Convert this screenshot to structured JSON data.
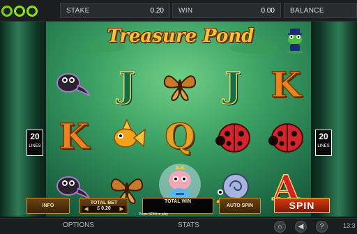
{
  "header": {
    "logo_text": "GECO",
    "stake_label": "STAKE",
    "stake_value": "0.20",
    "win_label": "WIN",
    "win_value": "0.00",
    "balance_label": "BALANCE"
  },
  "game": {
    "title": "Treasure Pond",
    "lines_left": {
      "count": "20",
      "label": "LINES"
    },
    "lines_right": {
      "count": "20",
      "label": "LINES"
    },
    "reels": [
      [
        "tadpole",
        "K",
        "tadpole"
      ],
      [
        "J",
        "goldfish",
        "butterfly"
      ],
      [
        "butterfly",
        "Q",
        "princess"
      ],
      [
        "J",
        "ladybird",
        "snail"
      ],
      [
        "K",
        "ladybird",
        "A"
      ]
    ]
  },
  "panel": {
    "info_label": "INFO",
    "total_bet_label": "TOTAL BET",
    "total_bet_value": "£ 0.20",
    "total_win_label": "TOTAL WIN",
    "auto_spin_label": "AUTO SPIN",
    "spin_label": "SPIN",
    "press_hint": "Press SPIN to play"
  },
  "footer": {
    "options_label": "OPTIONS",
    "stats_label": "STATS",
    "time": "13:3"
  },
  "icons": [
    "home-icon",
    "sound-icon",
    "help-icon"
  ],
  "colors": {
    "accent_green": "#8fe01e",
    "title_gold": "#f2c436",
    "spin_red": "#d33b0f"
  }
}
